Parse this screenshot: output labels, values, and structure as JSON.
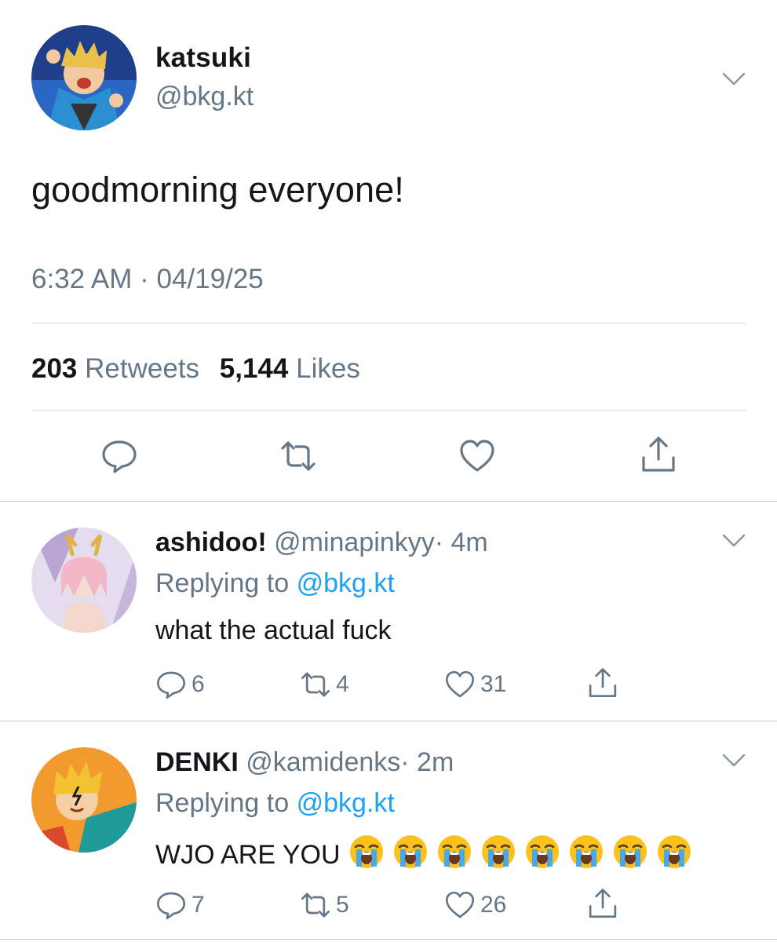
{
  "main_tweet": {
    "display_name": "katsuki",
    "handle": "@bkg.kt",
    "text": "goodmorning everyone!",
    "timestamp": "6:32 AM · 04/19/25",
    "retweets_count": "203",
    "retweets_label": "Retweets",
    "likes_count": "5,144",
    "likes_label": "Likes"
  },
  "replies": [
    {
      "display_name": "ashidoo!",
      "handle": "@minapinkyy",
      "time": "· 4m",
      "replying_prefix": "Replying to",
      "replying_handle": "@bkg.kt",
      "text": "what the actual fuck",
      "emoji_count": 0,
      "reply_count": "6",
      "retweet_count": "4",
      "like_count": "31"
    },
    {
      "display_name": "DENKI",
      "handle": "@kamidenks",
      "time": "· 2m",
      "replying_prefix": "Replying to",
      "replying_handle": "@bkg.kt",
      "text": "WJO ARE YOU",
      "emoji_count": 8,
      "emoji_name": "loudly-crying-face",
      "reply_count": "7",
      "retweet_count": "5",
      "like_count": "26"
    }
  ],
  "colors": {
    "text": "#14171a",
    "secondary": "#657786",
    "link": "#1da1f2",
    "divider": "#d6dbdf"
  }
}
